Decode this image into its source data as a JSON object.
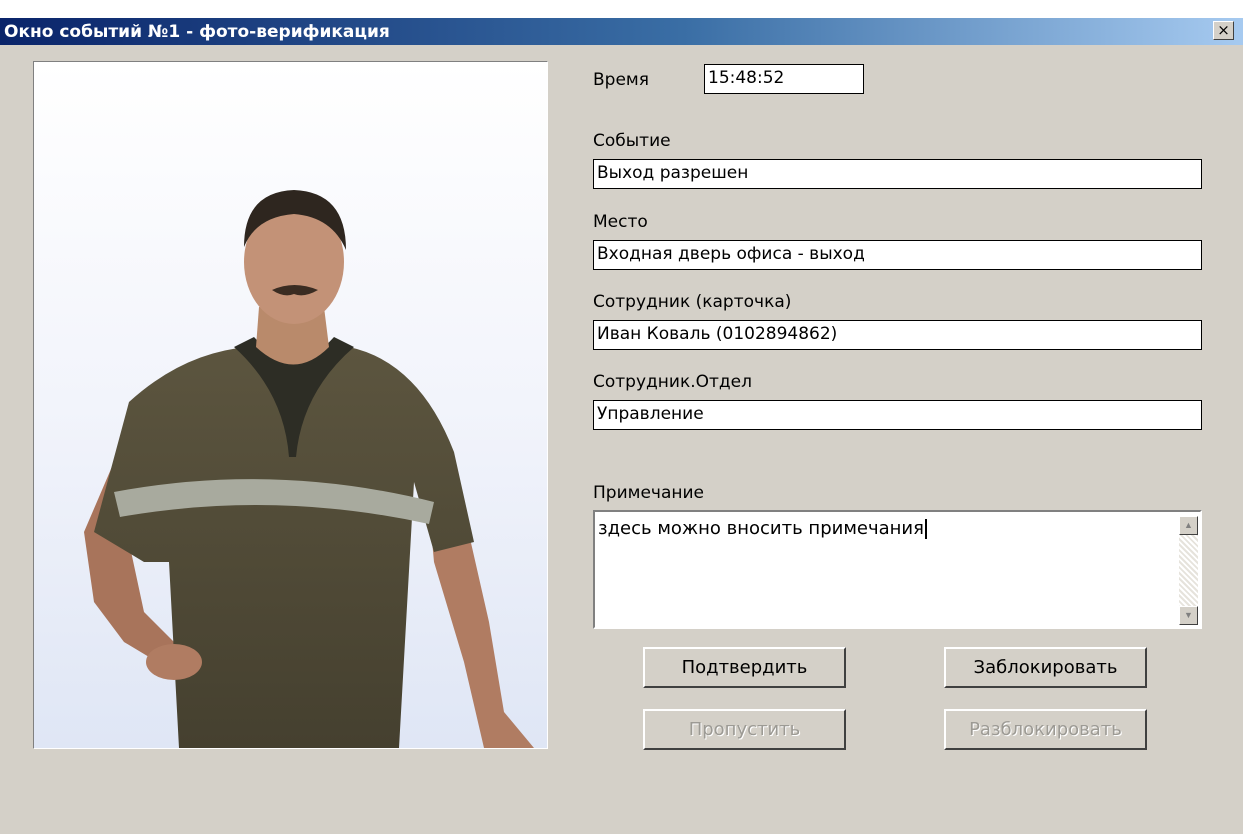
{
  "window": {
    "title": "Окно событий №1 - фото-верификация",
    "close_label": "×"
  },
  "fields": {
    "time": {
      "label": "Время",
      "value": "15:48:52"
    },
    "event": {
      "label": "Событие",
      "value": "Выход разрешен"
    },
    "place": {
      "label": "Место",
      "value": "Входная дверь офиса - выход"
    },
    "employee": {
      "label": "Сотрудник (карточка)",
      "value": "Иван Коваль (0102894862)"
    },
    "department": {
      "label": "Сотрудник.Отдел",
      "value": "Управление"
    },
    "note": {
      "label": "Примечание",
      "value": "здесь можно вносить примечания"
    }
  },
  "buttons": {
    "confirm": "Подтвердить",
    "block": "Заблокировать",
    "skip": "Пропустить",
    "unblock": "Разблокировать"
  },
  "icons": {
    "close": "close-icon",
    "scroll_up": "scroll-up-arrow-icon",
    "scroll_down": "scroll-down-arrow-icon"
  },
  "colors": {
    "titlebar_start": "#0a246a",
    "titlebar_end": "#a6caf0",
    "dialog_background": "#d4d0c8",
    "disabled_text": "#9c9a94"
  }
}
